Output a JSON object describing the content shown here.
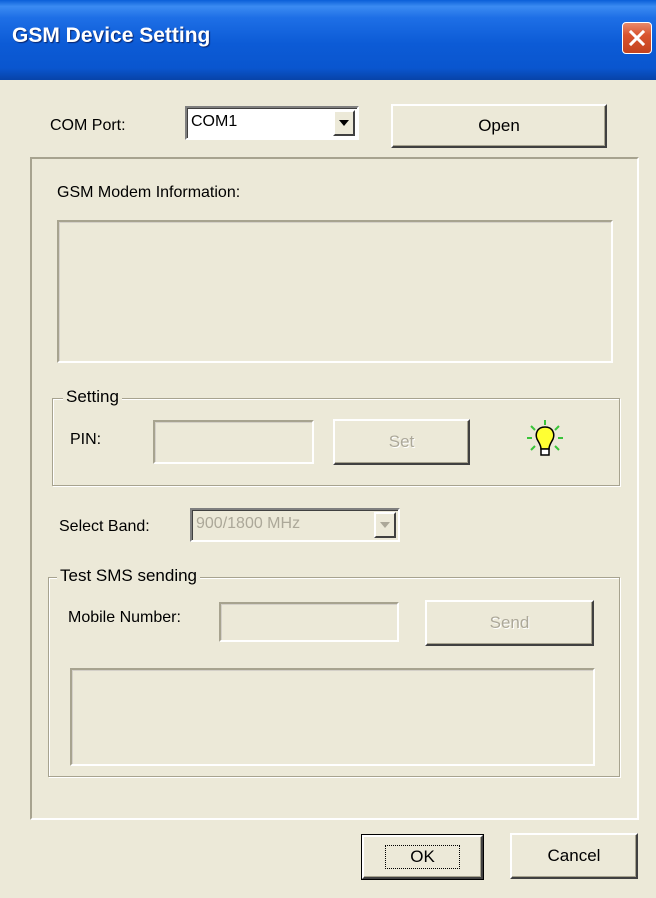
{
  "window": {
    "title": "GSM Device Setting"
  },
  "com_port": {
    "label": "COM Port:",
    "value": "COM1",
    "open_label": "Open"
  },
  "modem": {
    "label": "GSM Modem Information:"
  },
  "setting": {
    "group_label": "Setting",
    "pin_label": "PIN:",
    "set_label": "Set",
    "icon": "lightbulb-icon"
  },
  "band": {
    "label": "Select Band:",
    "value": "900/1800 MHz"
  },
  "sms": {
    "group_label": "Test SMS sending",
    "mobile_label": "Mobile Number:",
    "send_label": "Send"
  },
  "footer": {
    "ok_label": "OK",
    "cancel_label": "Cancel"
  }
}
